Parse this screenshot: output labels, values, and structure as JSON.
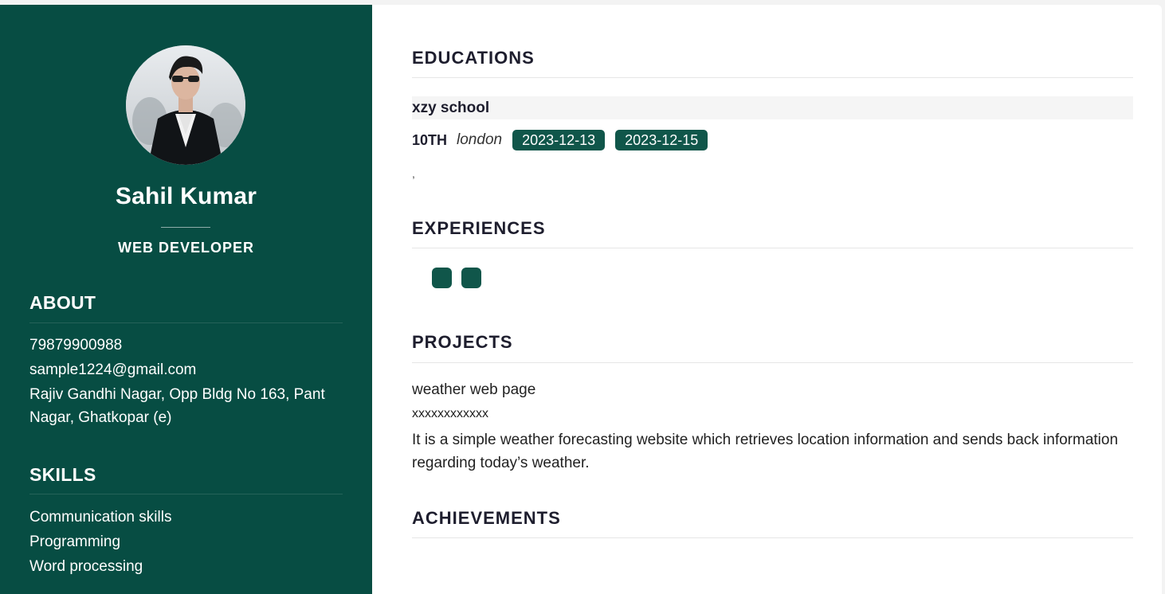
{
  "profile": {
    "name": "Sahil Kumar",
    "role": "WEB DEVELOPER"
  },
  "about": {
    "heading": "ABOUT",
    "phone": "79879900988",
    "email": "sample1224@gmail.com",
    "address": "Rajiv Gandhi Nagar, Opp Bldg No 163, Pant Nagar, Ghatkopar (e)"
  },
  "skills": {
    "heading": "SKILLS",
    "items": [
      "Communication skills",
      "Programming",
      "Word processing"
    ]
  },
  "educations": {
    "heading": "EDUCATIONS",
    "school": "xzy school",
    "degree": "10TH",
    "city": "london",
    "start_date": "2023-12-13",
    "end_date": "2023-12-15",
    "separator": ","
  },
  "experiences": {
    "heading": "EXPERIENCES"
  },
  "projects": {
    "heading": "PROJECTS",
    "title": "weather web page",
    "link": "xxxxxxxxxxxx",
    "description": "It is a simple weather forecasting website which retrieves location information and sends back information regarding today’s weather."
  },
  "achievements": {
    "heading": "ACHIEVEMENTS"
  },
  "colors": {
    "sidebar_bg": "#074d43",
    "badge_bg": "#10564a",
    "heading_text": "#1e1e2e"
  }
}
